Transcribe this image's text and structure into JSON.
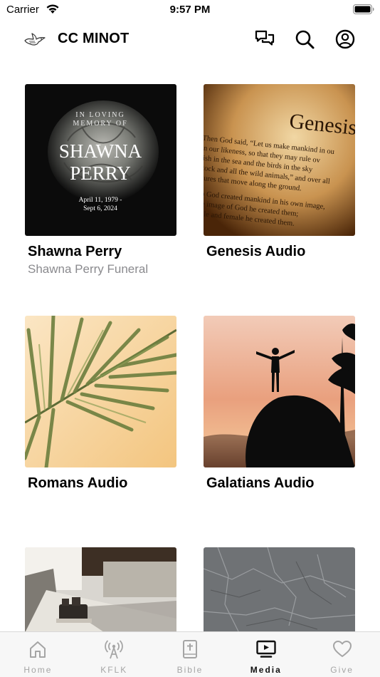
{
  "status": {
    "carrier": "Carrier",
    "time": "9:57 PM"
  },
  "header": {
    "title": "CC MINOT",
    "icons": [
      "logo-dove-icon",
      "chat-icon",
      "search-icon",
      "account-icon"
    ]
  },
  "cards": [
    {
      "title": "Shawna Perry",
      "subtitle": "Shawna Perry Funeral",
      "thumb": {
        "line1": "IN LOVING",
        "line2": "MEMORY OF",
        "name1": "SHAWNA",
        "name2": "PERRY",
        "dates1": "April 11, 1979 -",
        "dates2": "Sept 6, 2024"
      }
    },
    {
      "title": "Genesis Audio",
      "thumb": {
        "heading": "Genesis",
        "lines": [
          "Then God said, “Let us make mankind in ou",
          "in our likeness, so that they may rule ov",
          "fish in the sea and the birds in the sky",
          "stock and all the wild animals,” and over all",
          "atures that move along the ground.",
          "So God created mankind in his own image,",
          "the image of God he created them;",
          "male and female he created them."
        ]
      }
    },
    {
      "title": "Romans Audio"
    },
    {
      "title": "Galatians Audio"
    },
    {
      "title": ""
    },
    {
      "title": ""
    }
  ],
  "tabs": [
    {
      "label": "Home",
      "icon": "home-icon"
    },
    {
      "label": "KFLK",
      "icon": "radio-tower-icon"
    },
    {
      "label": "Bible",
      "icon": "bible-icon"
    },
    {
      "label": "Media",
      "icon": "media-tv-icon",
      "active": true
    },
    {
      "label": "Give",
      "icon": "heart-icon"
    }
  ],
  "colors": {
    "active_tab": "#111111",
    "inactive_tab": "#a5a5a5",
    "subtitle": "#8a8a8e"
  }
}
